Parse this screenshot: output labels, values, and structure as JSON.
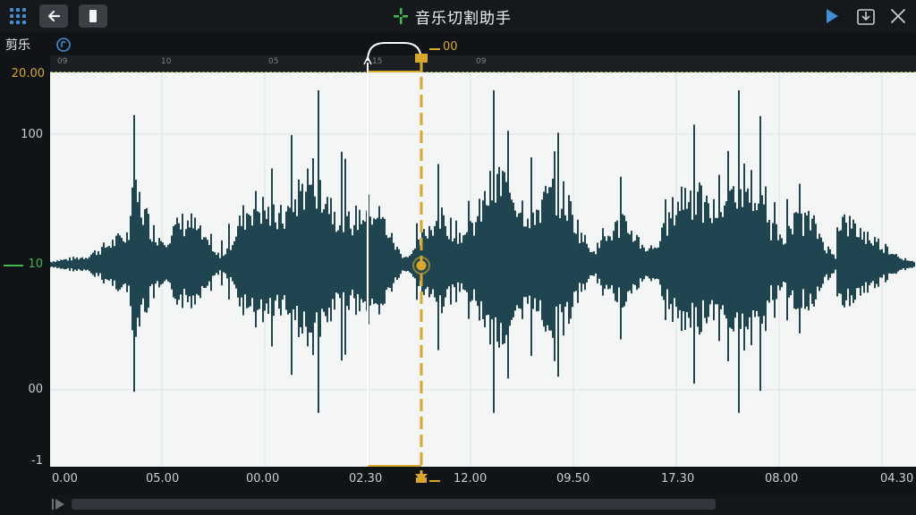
{
  "window": {
    "title": "音乐切割助手",
    "menu_icon": "grid-icon",
    "back_icon": "arrow-left-icon",
    "square_icon": "square-icon",
    "play_icon": "play-icon",
    "export_icon": "export-icon",
    "close_icon": "close-icon",
    "title_icon": "scissors-cross-icon"
  },
  "toolbar": {
    "label": "剪乐",
    "info_icon": "circle-info-icon"
  },
  "y_axis": {
    "labels": [
      "20.00",
      "100",
      "10",
      "00",
      "-1"
    ]
  },
  "ruler": {
    "labels": [
      "09",
      "10",
      "05",
      "15",
      "09"
    ]
  },
  "x_axis": {
    "labels": [
      "0.00",
      "05.00",
      "00.00",
      "02.30",
      "12.00",
      "09.50",
      "17.30",
      "08.00",
      "04.30"
    ]
  },
  "marker": {
    "label": "00"
  },
  "colors": {
    "waveform": "#1f4650",
    "accent": "#d9a729",
    "green": "#3fb950",
    "blue": "#3d8fd6"
  }
}
